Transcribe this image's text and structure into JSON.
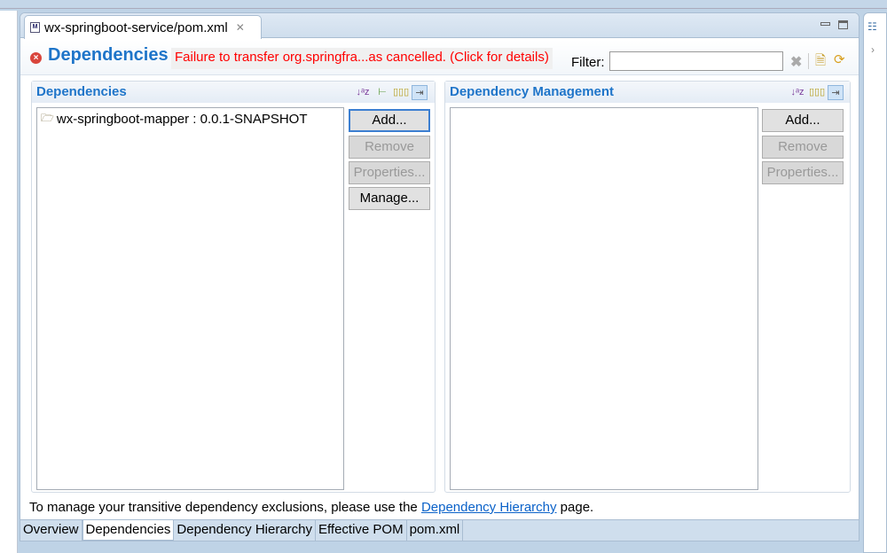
{
  "editor": {
    "tab_title": "wx-springboot-service/pom.xml",
    "page_title": "Dependencies",
    "error_message": "Failure to transfer org.springfra...as cancelled. (Click for details)",
    "filter_label": "Filter:",
    "filter_value": ""
  },
  "dependencies": {
    "title": "Dependencies",
    "items": [
      {
        "label": "wx-springboot-mapper : 0.0.1-SNAPSHOT"
      }
    ],
    "buttons": {
      "add": "Add...",
      "remove": "Remove",
      "properties": "Properties...",
      "manage": "Manage..."
    }
  },
  "management": {
    "title": "Dependency Management",
    "items": [],
    "buttons": {
      "add": "Add...",
      "remove": "Remove",
      "properties": "Properties..."
    }
  },
  "footer": {
    "text_before": "To manage your transitive dependency exclusions, please use the ",
    "link": "Dependency Hierarchy",
    "text_after": " page."
  },
  "page_tabs": [
    {
      "label": "Overview"
    },
    {
      "label": "Dependencies",
      "active": true
    },
    {
      "label": "Dependency Hierarchy"
    },
    {
      "label": "Effective POM"
    },
    {
      "label": "pom.xml"
    }
  ]
}
